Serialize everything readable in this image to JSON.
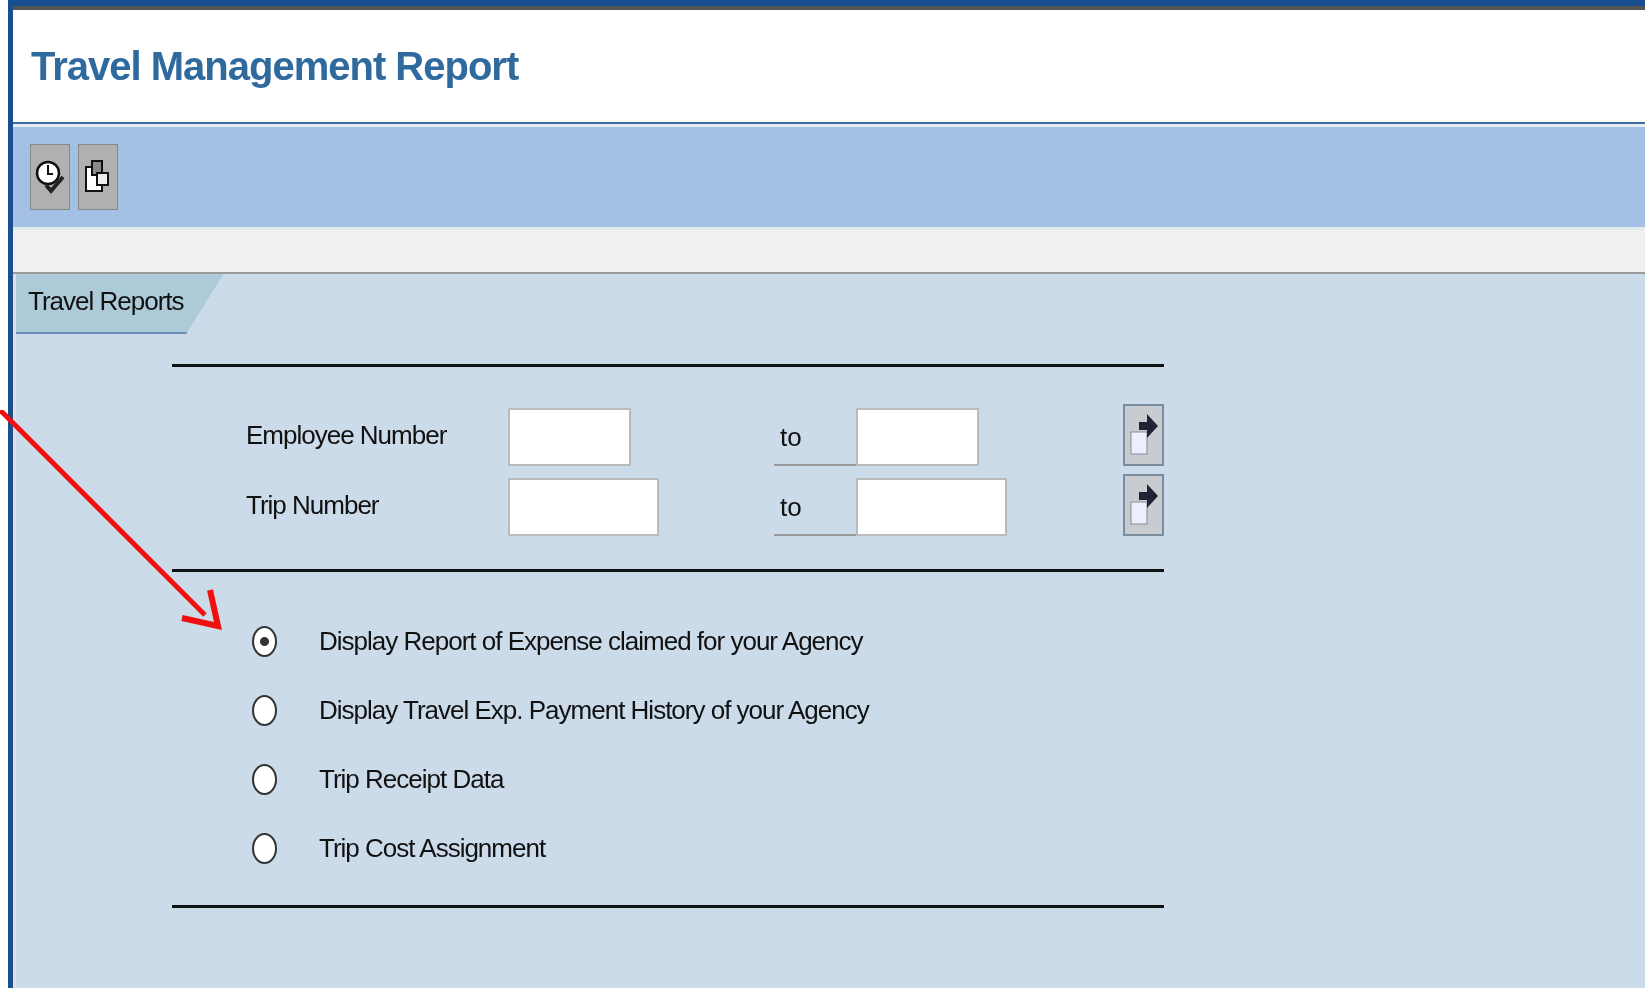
{
  "title": "Travel Management Report",
  "toolbar": {
    "buttons": [
      {
        "kind": "clock"
      },
      {
        "kind": "copy"
      }
    ]
  },
  "tab": {
    "label": "Travel Reports",
    "selected": true
  },
  "ranges": [
    {
      "label": "Employee Number",
      "to_label": "to"
    },
    {
      "label": "Trip Number",
      "to_label": "to"
    }
  ],
  "options": [
    {
      "label": "Display Report of Expense claimed for your Agency",
      "selected": true
    },
    {
      "label": "Display Travel Exp. Payment History of your Agency",
      "selected": false
    },
    {
      "label": "Trip Receipt Data",
      "selected": false
    },
    {
      "label": "Trip Cost Assignment",
      "selected": false
    }
  ]
}
